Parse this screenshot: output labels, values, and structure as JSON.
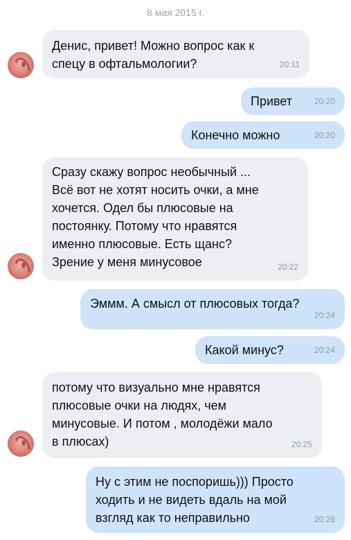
{
  "chat": {
    "date": "8 мая 2015 г.",
    "messages": [
      {
        "dir": "in",
        "text": "Денис, привет! Можно вопрос как к\nспецу в офтальмологии?",
        "time": "20:11"
      },
      {
        "dir": "out",
        "text": "Привет",
        "time": "20:20"
      },
      {
        "dir": "out",
        "text": "Конечно можно",
        "time": "20:20"
      },
      {
        "dir": "in",
        "text": "Сразу скажу вопрос необычный ...\nВсё вот не хотят носить очки, а мне\nхочется. Одел бы плюсовые на\nпостоянку. Потому что нравятся\nименно плюсовые. Есть щанс?\nЗрение у меня минусовое",
        "time": "20:22"
      },
      {
        "dir": "out",
        "text": "Эммм. А смысл от плюсовых тогда?",
        "time": "20:24"
      },
      {
        "dir": "out",
        "text": "Какой минус?",
        "time": "20:24"
      },
      {
        "dir": "in",
        "text": "потому что визуально мне нравятся\nплюсовые очки на людях, чем\nминусовые. И потом , молодёжи мало\nв плюсах)",
        "time": "20:25"
      },
      {
        "dir": "out",
        "text": "Ну с этим не поспоришь))) Просто\nходить и не видеть вдаль на мой\nвзгляд как то неправильно",
        "time": "20:26"
      }
    ]
  },
  "colors": {
    "incoming_bubble": "#eceef2",
    "outgoing_bubble": "#cfe4fb",
    "timestamp": "#8f9aa6"
  },
  "icons": {
    "sender_avatar": "ear-avatar-icon"
  }
}
